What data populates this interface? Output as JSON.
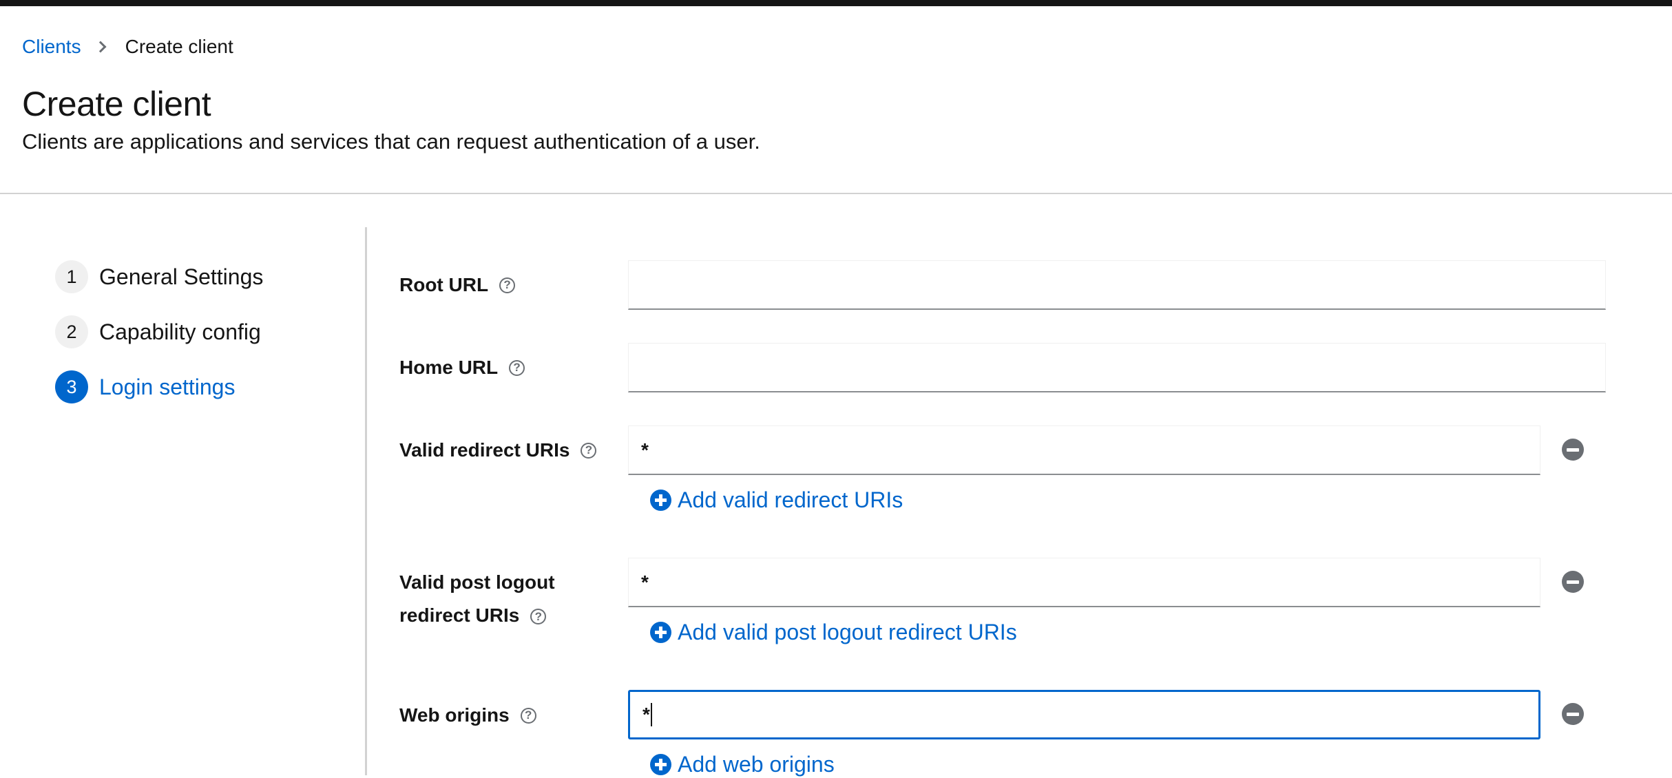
{
  "breadcrumb": {
    "parent": "Clients",
    "current": "Create client"
  },
  "header": {
    "title": "Create client",
    "description": "Clients are applications and services that can request authentication of a user."
  },
  "wizard": {
    "steps": [
      {
        "number": "1",
        "label": "General Settings",
        "active": false
      },
      {
        "number": "2",
        "label": "Capability config",
        "active": false
      },
      {
        "number": "3",
        "label": "Login settings",
        "active": true
      }
    ]
  },
  "form": {
    "root_url": {
      "label": "Root URL",
      "value": ""
    },
    "home_url": {
      "label": "Home URL",
      "value": ""
    },
    "valid_redirect_uris": {
      "label": "Valid redirect URIs",
      "value": "*",
      "add_label": "Add valid redirect URIs"
    },
    "valid_post_logout": {
      "label_line1": "Valid post logout",
      "label_line2": "redirect URIs",
      "value": "*",
      "add_label": "Add valid post logout redirect URIs"
    },
    "web_origins": {
      "label": "Web origins",
      "value": "*",
      "add_label": "Add web origins"
    }
  },
  "icons": {
    "help": "?",
    "help_icon_name": "question-circle-icon",
    "remove_icon_name": "minus-circle-icon",
    "add_icon_name": "plus-circle-icon"
  },
  "colors": {
    "accent": "#0066cc",
    "text": "#151515",
    "icon_gray": "#6a6e73",
    "top_bar": "#151515"
  }
}
